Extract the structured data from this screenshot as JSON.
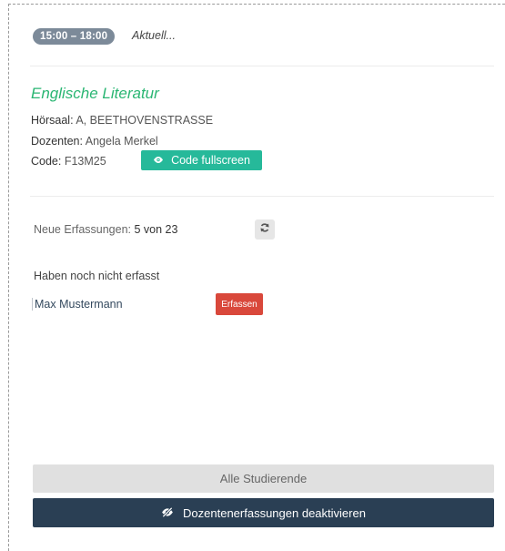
{
  "session": {
    "time": "15:00 – 18:00",
    "status": "Aktuell..."
  },
  "course": {
    "title": "Englische Literatur",
    "room_label": "Hörsaal:",
    "room_value": " A, BEETHOVENSTRASSE",
    "lecturer_label": "Dozenten:",
    "lecturer_value": " Angela Merkel",
    "code_label": "Code:",
    "code_value": " F13M25",
    "code_button": "Code fullscreen"
  },
  "counter": {
    "label": "Neue Erfassungen: ",
    "value": "5 von 23"
  },
  "pending": {
    "heading": "Haben noch nicht erfasst",
    "students": [
      {
        "name": "Max Mustermann",
        "action": "Erfassen"
      }
    ]
  },
  "footer": {
    "all_students": "Alle Studierende",
    "deactivate": "Dozentenerfassungen deaktivieren"
  },
  "colors": {
    "accent_green": "#26b99a",
    "danger_red": "#d9483b",
    "navy": "#2a3f54",
    "badge_gray": "#7c8a99"
  },
  "icons": {
    "code_button": "eye-icon",
    "refresh": "refresh-icon",
    "deactivate": "eye-slash-icon"
  }
}
